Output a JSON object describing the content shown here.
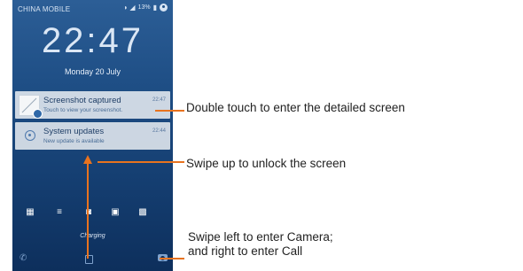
{
  "status_bar": {
    "carrier": "CHINA MOBILE",
    "battery_percent": "13%"
  },
  "lock_screen": {
    "time": "22:47",
    "date": "Monday 20 July",
    "charging_text": "Charging"
  },
  "notifications": [
    {
      "title": "Screenshot captured",
      "subtitle": "Touch to view your screenshot.",
      "time": "22:47"
    },
    {
      "title": "System updates",
      "subtitle": "New update is available",
      "time": "22:44"
    }
  ],
  "shortcuts": [
    "calculator-icon",
    "music-icon",
    "camera-icon",
    "contact-icon",
    "qr-scan-icon"
  ],
  "callouts": {
    "detail": "Double touch to enter the detailed screen",
    "unlock": "Swipe up to unlock the screen",
    "camera_line1": "Swipe left to enter Camera;",
    "camera_line2": "and right to enter Call"
  },
  "colors": {
    "arrow": "#e8731f",
    "screen_top": "#2c5e96",
    "screen_bottom": "#0d2f5c"
  }
}
